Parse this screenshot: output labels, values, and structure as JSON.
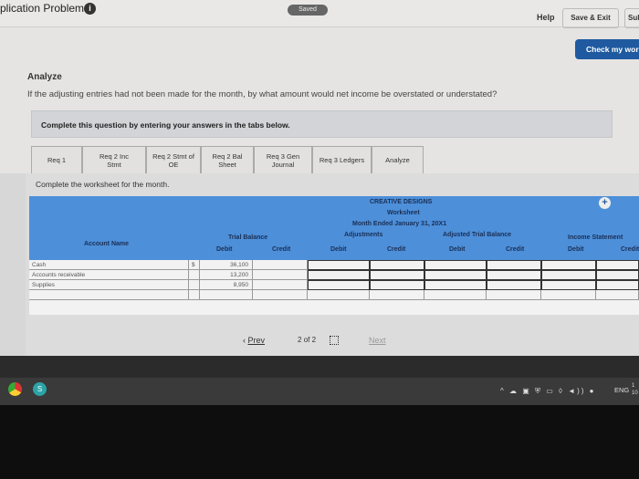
{
  "header": {
    "title": "plication Problems",
    "saved_badge": "Saved",
    "help": "Help",
    "save_exit": "Save & Exit",
    "submit": "Sub",
    "check_work": "Check my wor"
  },
  "question": {
    "heading": "Analyze",
    "text": "If the adjusting entries had not been made for the month, by what amount would net income be overstated or understated?",
    "instructions": "Complete this question by entering your answers in the tabs below."
  },
  "tabs": [
    {
      "label": "Req 1"
    },
    {
      "label": "Req 2 Inc\nStmt"
    },
    {
      "label": "Req 2 Stmt of\nOE"
    },
    {
      "label": "Req 2 Bal\nSheet"
    },
    {
      "label": "Req 3 Gen\nJournal"
    },
    {
      "label": "Req 3 Ledgers"
    },
    {
      "label": "Analyze"
    }
  ],
  "panel": {
    "instructions": "Complete the worksheet for the month."
  },
  "worksheet": {
    "company": "CREATIVE DESIGNS",
    "title": "Worksheet",
    "period": "Month Ended January 31, 20X1",
    "account_name_header": "Account Name",
    "groups": {
      "trial_balance": "Trial Balance",
      "adjustments": "Adjustments",
      "adjusted_trial_balance": "Adjusted Trial Balance",
      "income_statement": "Income Statement"
    },
    "debit": "Debit",
    "credit": "Credit",
    "currency": "$",
    "rows": [
      {
        "account": "Cash",
        "tb_debit": "36,100"
      },
      {
        "account": "Accounts receivable",
        "tb_debit": "13,200"
      },
      {
        "account": "Supplies",
        "tb_debit": "8,950"
      }
    ]
  },
  "pager": {
    "prev": "Prev",
    "page": "2",
    "of": "of",
    "total": "2",
    "next": "Next"
  },
  "taskbar": {
    "lang": "ENG",
    "clock_top": "1",
    "clock_bottom": "10"
  },
  "colors": {
    "accent": "#1f5aa0",
    "worksheet_header": "#4d8fd9"
  }
}
